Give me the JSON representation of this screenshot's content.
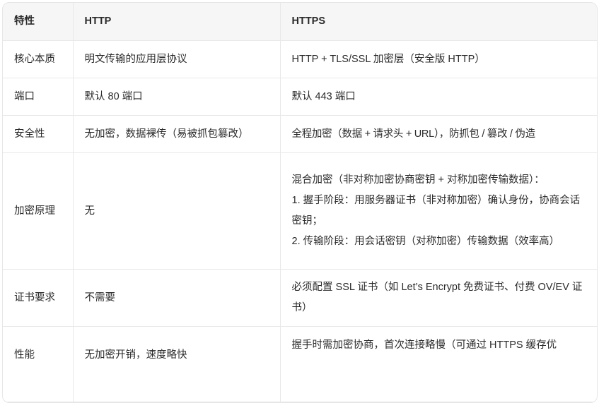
{
  "headers": [
    "特性",
    "HTTP",
    "HTTPS"
  ],
  "rows": [
    {
      "feature": "核心本质",
      "http": "明文传输的应用层协议",
      "https": [
        "HTTP + TLS/SSL 加密层（安全版 HTTP）"
      ]
    },
    {
      "feature": "端口",
      "http": "默认 80 端口",
      "https": [
        "默认 443 端口"
      ]
    },
    {
      "feature": "安全性",
      "http": "无加密，数据裸传（易被抓包篡改）",
      "https": [
        "全程加密（数据 + 请求头 + URL），防抓包 / 篡改 / 伪造"
      ]
    },
    {
      "feature": "加密原理",
      "http": "无",
      "https": [
        "混合加密（非对称加密协商密钥 + 对称加密传输数据）：",
        "1. 握手阶段：用服务器证书（非对称加密）确认身份，协商会话密钥；",
        "2. 传输阶段：用会话密钥（对称加密）传输数据（效率高）"
      ]
    },
    {
      "feature": "证书要求",
      "http": "不需要",
      "https": [
        "必须配置 SSL 证书（如 Let’s Encrypt 免费证书、付费 OV/EV 证书）"
      ]
    },
    {
      "feature": "性能",
      "http": "无加密开销，速度略快",
      "https": [
        "握手时需加密协商，首次连接略慢（可通过 HTTPS 缓存优"
      ]
    }
  ]
}
